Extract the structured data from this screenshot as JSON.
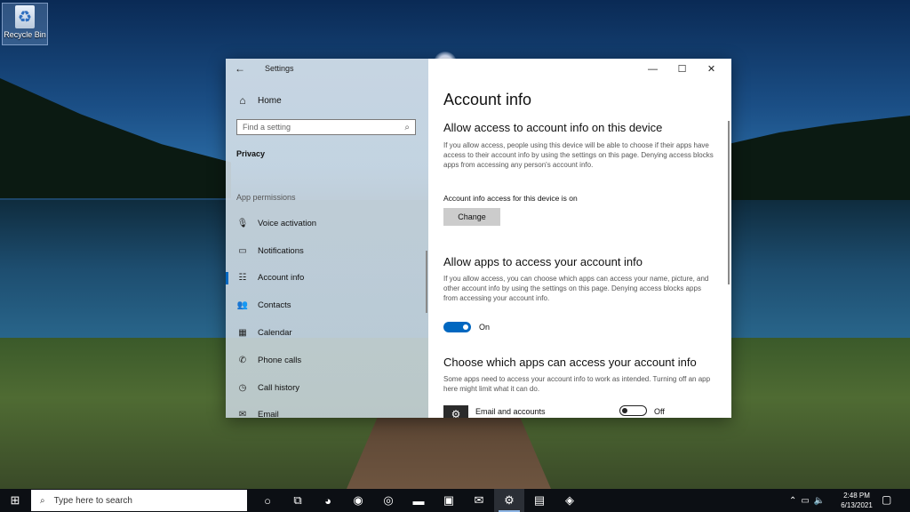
{
  "desktop": {
    "recycle_bin_label": "Recycle Bin"
  },
  "window": {
    "title": "Settings",
    "back_icon": "arrow-left-icon",
    "controls": [
      "—",
      "☐",
      "✕"
    ]
  },
  "sidebar": {
    "home_label": "Home",
    "search_placeholder": "Find a setting",
    "category": "Privacy",
    "section_label": "App permissions",
    "items": [
      {
        "label": "Voice activation",
        "icon": "microphone-icon",
        "glyph": "🎙"
      },
      {
        "label": "Notifications",
        "icon": "notification-icon",
        "glyph": "▭"
      },
      {
        "label": "Account info",
        "icon": "account-info-icon",
        "glyph": "☷",
        "active": true
      },
      {
        "label": "Contacts",
        "icon": "contacts-icon",
        "glyph": "👥"
      },
      {
        "label": "Calendar",
        "icon": "calendar-icon",
        "glyph": "▦"
      },
      {
        "label": "Phone calls",
        "icon": "phone-icon",
        "glyph": "✆"
      },
      {
        "label": "Call history",
        "icon": "history-icon",
        "glyph": "◷"
      },
      {
        "label": "Email",
        "icon": "email-icon",
        "glyph": "✉"
      }
    ]
  },
  "main": {
    "title": "Account info",
    "section1": {
      "heading": "Allow access to account info on this device",
      "description": "If you allow access, people using this device will be able to choose if their apps have access to their account info by using the settings on this page. Denying access blocks apps from accessing any person's account info.",
      "status": "Account info access for this device is on",
      "button": "Change"
    },
    "section2": {
      "heading": "Allow apps to access your account info",
      "description": "If you allow access, you can choose which apps can access your name, picture, and other account info by using the settings on this page. Denying access blocks apps from accessing your account info.",
      "toggle_label": "On"
    },
    "section3": {
      "heading": "Choose which apps can access your account info",
      "description": "Some apps need to access your account info to work as intended. Turning off an app here might limit what it can do.",
      "app_name": "Email and accounts",
      "toggle_label": "Off"
    }
  },
  "taskbar": {
    "search_placeholder": "Type here to search",
    "time": "2:48 PM",
    "date": "6/13/2021",
    "apps": [
      {
        "icon": "cortana-icon",
        "glyph": "○"
      },
      {
        "icon": "task-view-icon",
        "glyph": "⧉"
      },
      {
        "icon": "edge-icon",
        "glyph": "◕"
      },
      {
        "icon": "firefox-icon",
        "glyph": "◉"
      },
      {
        "icon": "chrome-icon",
        "glyph": "◎"
      },
      {
        "icon": "file-explorer-icon",
        "glyph": "▬"
      },
      {
        "icon": "store-icon",
        "glyph": "▣"
      },
      {
        "icon": "mail-icon",
        "glyph": "✉"
      },
      {
        "icon": "settings-icon",
        "glyph": "⚙",
        "active": true
      },
      {
        "icon": "remote-desktop-icon",
        "glyph": "▤"
      },
      {
        "icon": "azure-icon",
        "glyph": "◈"
      }
    ]
  }
}
